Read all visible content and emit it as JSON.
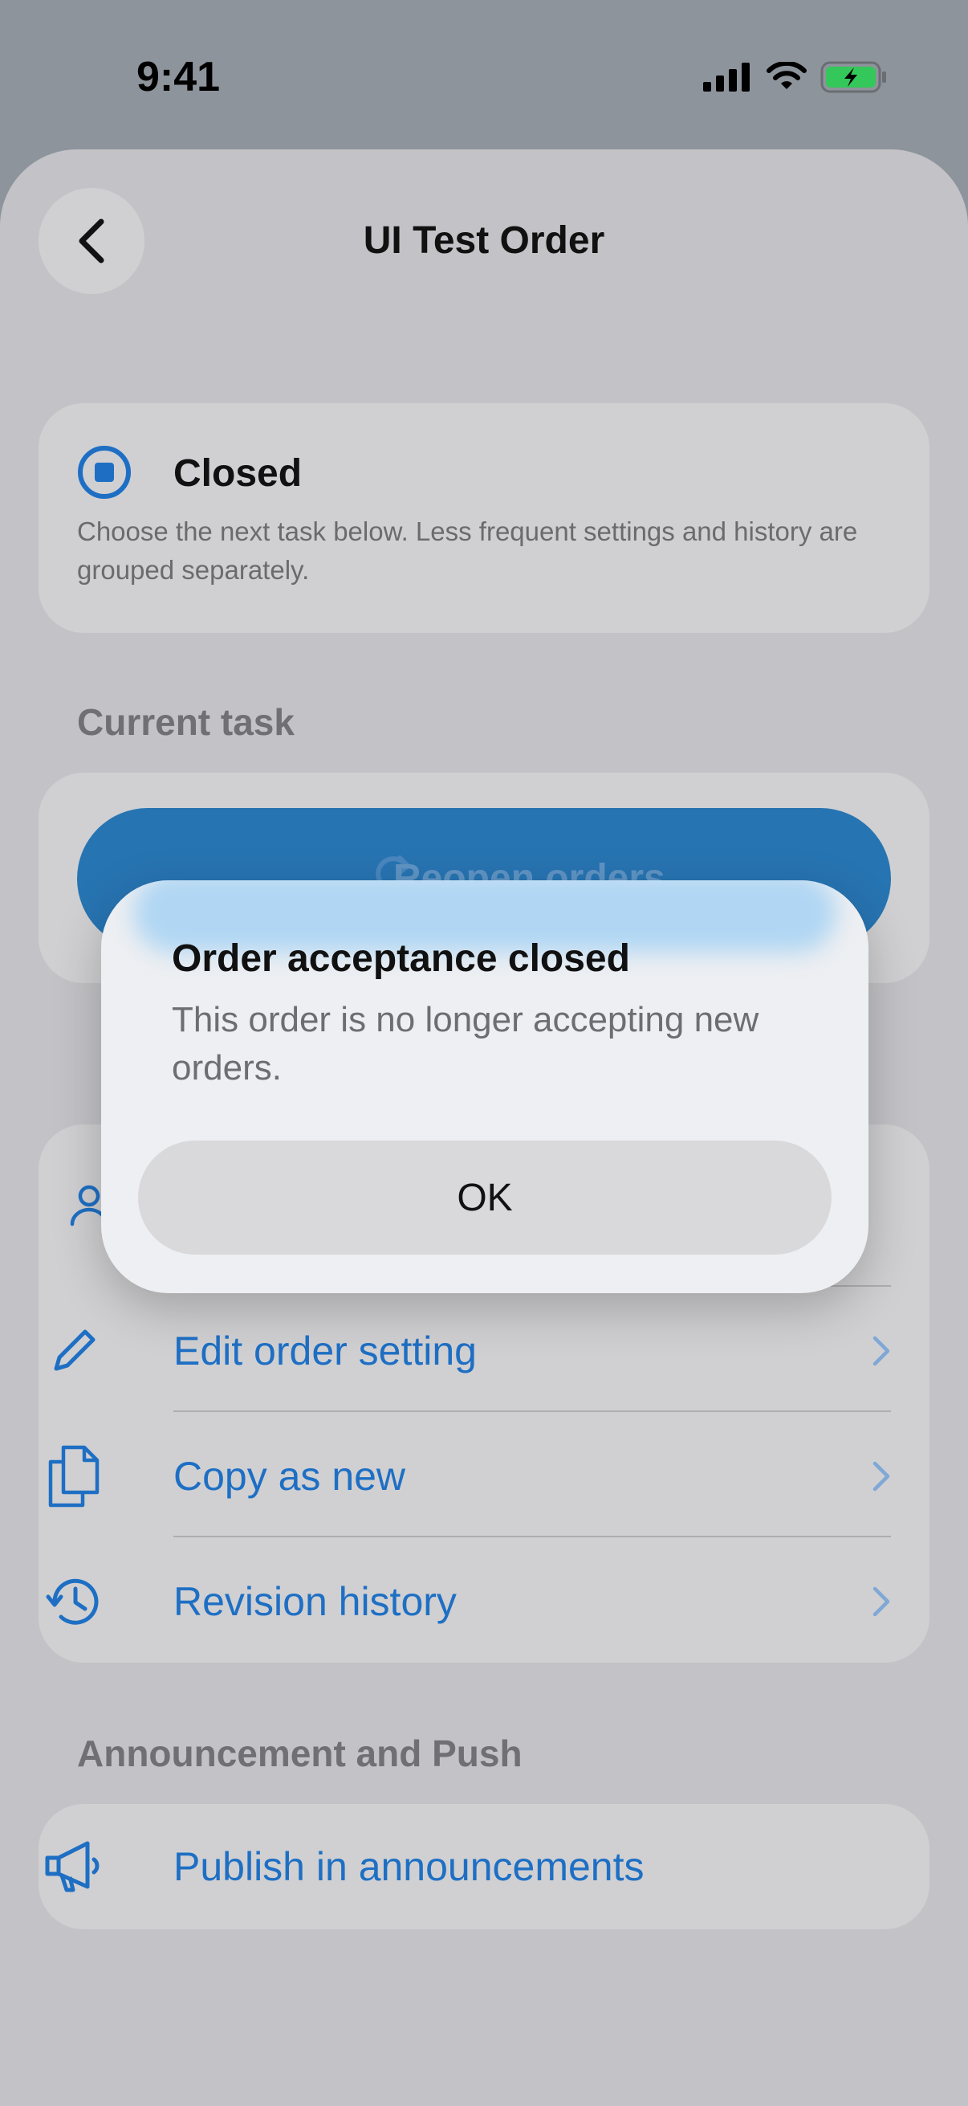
{
  "status_bar": {
    "time": "9:41"
  },
  "header": {
    "title": "UI Test Order"
  },
  "status_card": {
    "title": "Closed",
    "description": "Choose the next task below. Less frequent settings and history are grouped separately."
  },
  "sections": {
    "current_task": "Current task",
    "announcement": "Announcement and Push"
  },
  "current_task": {
    "button_label": "Reopen orders"
  },
  "actions": [
    {
      "label": "Edit order setting",
      "icon": "pencil-icon"
    },
    {
      "label": "Copy as new",
      "icon": "copy-icon"
    },
    {
      "label": "Revision history",
      "icon": "history-icon"
    }
  ],
  "announcement": {
    "label": "Publish in announcements",
    "icon": "megaphone-icon"
  },
  "dialog": {
    "title": "Order acceptance closed",
    "message": "This order is no longer accepting new orders.",
    "ok_label": "OK"
  },
  "colors": {
    "accent": "#1e6fc4",
    "primary_button": "#2774b2",
    "battery": "#34c759"
  }
}
